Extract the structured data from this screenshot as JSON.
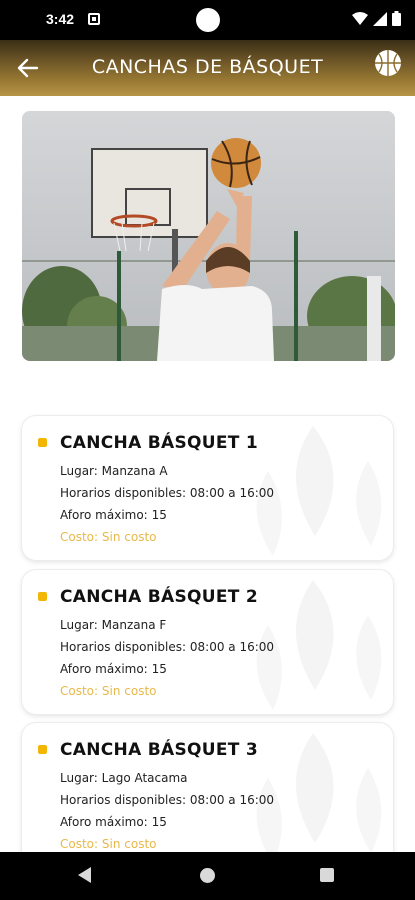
{
  "status_bar": {
    "time": "3:42"
  },
  "app_bar": {
    "title": "CANCHAS DE BÁSQUET",
    "back_icon": "arrow-left-icon",
    "action_icon": "basketball-icon"
  },
  "courts": [
    {
      "name": "CANCHA BÁSQUET 1",
      "location_label": "Lugar:",
      "location": "Manzana A",
      "hours_label": "Horarios disponibles:",
      "hours": "08:00 a 16:00",
      "capacity_label": "Aforo máximo:",
      "capacity": "15",
      "cost_label": "Costo:",
      "cost": "Sin costo"
    },
    {
      "name": "CANCHA BÁSQUET 2",
      "location_label": "Lugar:",
      "location": "Manzana F",
      "hours_label": "Horarios disponibles:",
      "hours": "08:00 a 16:00",
      "capacity_label": "Aforo máximo:",
      "capacity": "15",
      "cost_label": "Costo:",
      "cost": "Sin costo"
    },
    {
      "name": "CANCHA BÁSQUET 3",
      "location_label": "Lugar:",
      "location": "Lago Atacama",
      "hours_label": "Horarios disponibles:",
      "hours": "08:00 a 16:00",
      "capacity_label": "Aforo máximo:",
      "capacity": "15",
      "cost_label": "Costo:",
      "cost": "Sin costo"
    }
  ],
  "colors": {
    "accent": "#f2b705",
    "cost": "#e8b84a",
    "header_start": "#3a2f16",
    "header_end": "#b69548"
  }
}
